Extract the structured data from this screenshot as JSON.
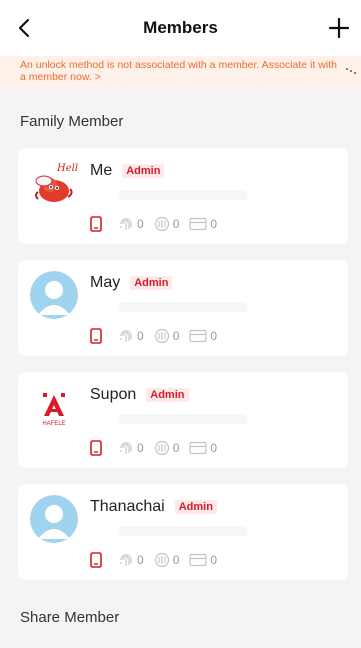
{
  "header": {
    "title": "Members",
    "back_icon": "chevron-left-icon",
    "add_icon": "plus-icon"
  },
  "banner": {
    "text": "An unlock method is not associated with a member. Associate it with a member now. >",
    "color": "#f06a2c",
    "background": "#fdf1ea"
  },
  "sections": {
    "family_title": "Family Member",
    "share_title": "Share Member"
  },
  "colors": {
    "accent_red": "#d51b2a",
    "muted_gray": "#9a9a9a",
    "avatar_blue": "#9fd3ee"
  },
  "members": [
    {
      "name": "Me",
      "role": "Admin",
      "avatar": "cartoon-hello-avatar",
      "fingerprint": "0",
      "face": "0",
      "card": "0"
    },
    {
      "name": "May",
      "role": "Admin",
      "avatar": "default-person-avatar",
      "fingerprint": "0",
      "face": "0",
      "card": "0"
    },
    {
      "name": "Supon",
      "role": "Admin",
      "avatar": "hafele-logo-avatar",
      "avatar_logo_text": "HAFELE",
      "fingerprint": "0",
      "face": "0",
      "card": "0"
    },
    {
      "name": "Thanachai",
      "role": "Admin",
      "avatar": "default-person-avatar",
      "fingerprint": "0",
      "face": "0",
      "card": "0"
    }
  ]
}
